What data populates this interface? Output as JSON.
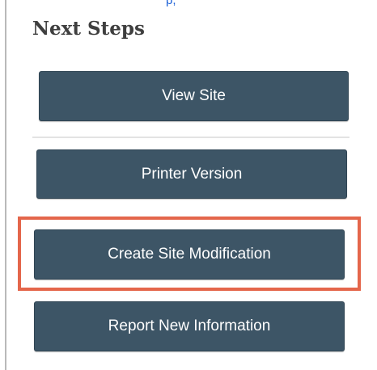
{
  "header": {
    "top_fragment": "p,"
  },
  "next_steps": {
    "title": "Next Steps",
    "buttons": [
      {
        "label": "View Site"
      },
      {
        "label": "Printer Version"
      },
      {
        "label": "Create Site Modification",
        "highlighted": true
      },
      {
        "label": "Report New Information"
      }
    ]
  },
  "colors": {
    "button_bg": "#3d5566",
    "button_text": "#ffffff",
    "highlight_border": "#e4664b",
    "title_text": "#3f3f3f"
  }
}
